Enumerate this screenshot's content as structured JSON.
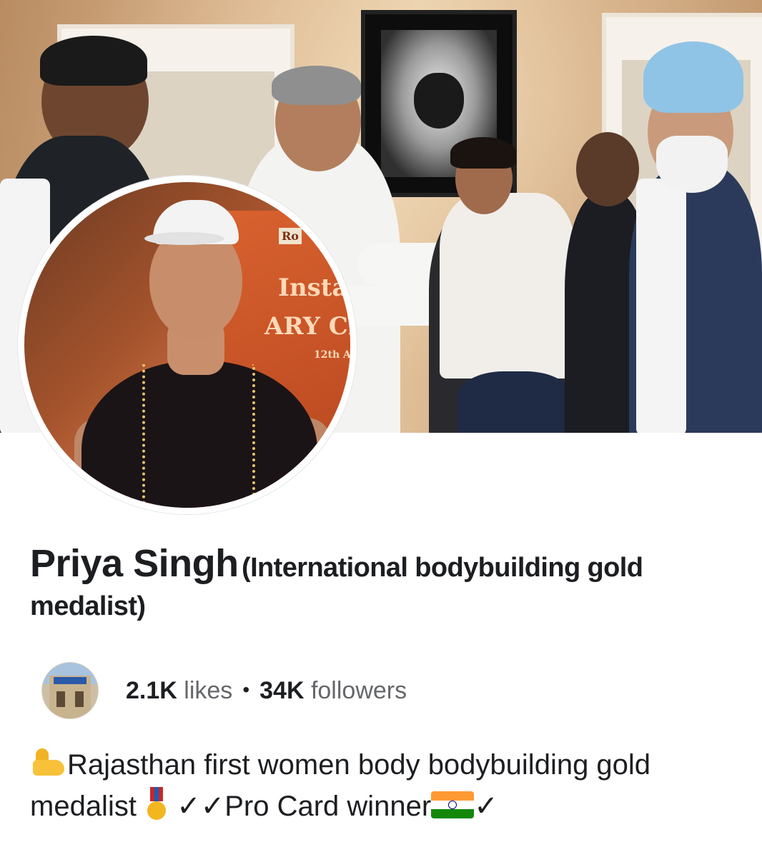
{
  "cover": {
    "banner_text_top": "Ro",
    "banner_text_mid": "Installa",
    "banner_text_low": "ARY CLU",
    "banner_text_date": "12th A"
  },
  "profile": {
    "name": "Priya Singh",
    "name_suffix": "(International bodybuilding gold",
    "name_suffix_line2": "medalist)"
  },
  "stats": {
    "likes_count": "2.1K",
    "likes_label": "likes",
    "separator": "•",
    "followers_count": "34K",
    "followers_label": "followers"
  },
  "bio": {
    "arm_icon": "flexed-biceps-icon",
    "line1_text": "Rajasthan first women body bodybuilding gold",
    "line2_text_a": "medalist",
    "medal_icon": "military-medal-icon",
    "line2_text_b": "✓✓Pro Card winner",
    "flag_icon": "india-flag-icon",
    "line2_text_c": "✓"
  },
  "colors": {
    "text_primary": "#1c1e21",
    "text_secondary": "#65676b",
    "background": "#ffffff"
  }
}
